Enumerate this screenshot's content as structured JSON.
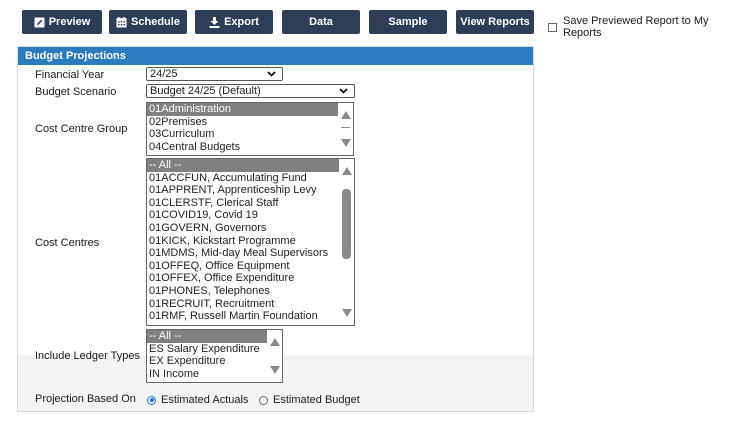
{
  "toolbar": {
    "buttons": [
      {
        "label": "Preview",
        "icon": "pencil-icon"
      },
      {
        "label": "Schedule",
        "icon": "calendar-icon"
      },
      {
        "label": "Export",
        "icon": "download-icon"
      },
      {
        "label": "Data"
      },
      {
        "label": "Sample"
      },
      {
        "label": "View Reports"
      }
    ],
    "save_label": "Save Previewed Report to My Reports",
    "save_checked": false
  },
  "panel": {
    "title": "Budget Projections",
    "financial_year": {
      "label": "Financial Year",
      "value": "24/25"
    },
    "budget_scenario": {
      "label": "Budget Scenario",
      "value": "Budget 24/25 (Default)"
    },
    "cost_centre_group": {
      "label": "Cost Centre Group",
      "options": [
        "01Administration",
        "02Premises",
        "03Curriculum",
        "04Central Budgets"
      ],
      "selected": 0
    },
    "cost_centres": {
      "label": "Cost Centres",
      "options": [
        "-- All --",
        "01ACCFUN, Accumulating Fund",
        "01APPRENT, Apprenticeship Levy",
        "01CLERSTF, Clerical Staff",
        "01COVID19, Covid 19",
        "01GOVERN, Governors",
        "01KICK, Kickstart Programme",
        "01MDMS, Mid-day Meal Supervisors",
        "01OFFEQ, Office Equipment",
        "01OFFEX, Office Expenditure",
        "01PHONES, Telephones",
        "01RECRUIT, Recruitment",
        "01RMF, Russell Martin Foundation"
      ],
      "selected": 0
    },
    "ledger_types": {
      "label": "Include Ledger Types",
      "options": [
        "-- All --",
        "ES Salary Expenditure",
        "EX Expenditure",
        "IN Income"
      ],
      "selected": 0
    },
    "projection": {
      "label": "Projection Based On",
      "options": [
        "Estimated Actuals",
        "Estimated Budget"
      ],
      "selected": 0
    }
  },
  "colors": {
    "toolbar_button": "#2e3e57",
    "panel_header": "#2b7bbf",
    "selection": "#808080"
  }
}
